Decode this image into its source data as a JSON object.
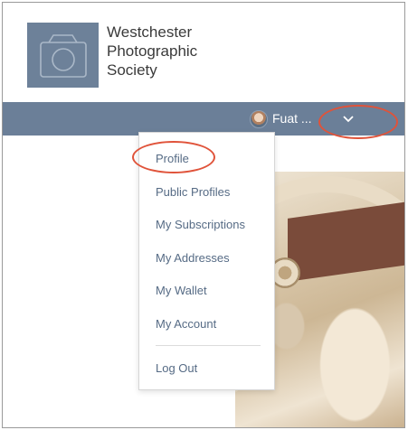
{
  "header": {
    "logo_icon": "camera-icon",
    "org_name_lines": [
      "Westchester",
      "Photographic",
      "Society"
    ]
  },
  "navbar": {
    "user_name": "Fuat ...",
    "avatar_icon": "user-avatar",
    "dropdown_icon": "chevron-down-icon"
  },
  "user_menu": {
    "items": [
      {
        "label": "Profile"
      },
      {
        "label": "Public Profiles"
      },
      {
        "label": "My Subscriptions"
      },
      {
        "label": "My Addresses"
      },
      {
        "label": "My Wallet"
      },
      {
        "label": "My Account"
      },
      {
        "label": "Log Out"
      }
    ]
  },
  "colors": {
    "brand_blue": "#6b7f98",
    "menu_text": "#566b85",
    "highlight_annotation": "#e0533a"
  }
}
